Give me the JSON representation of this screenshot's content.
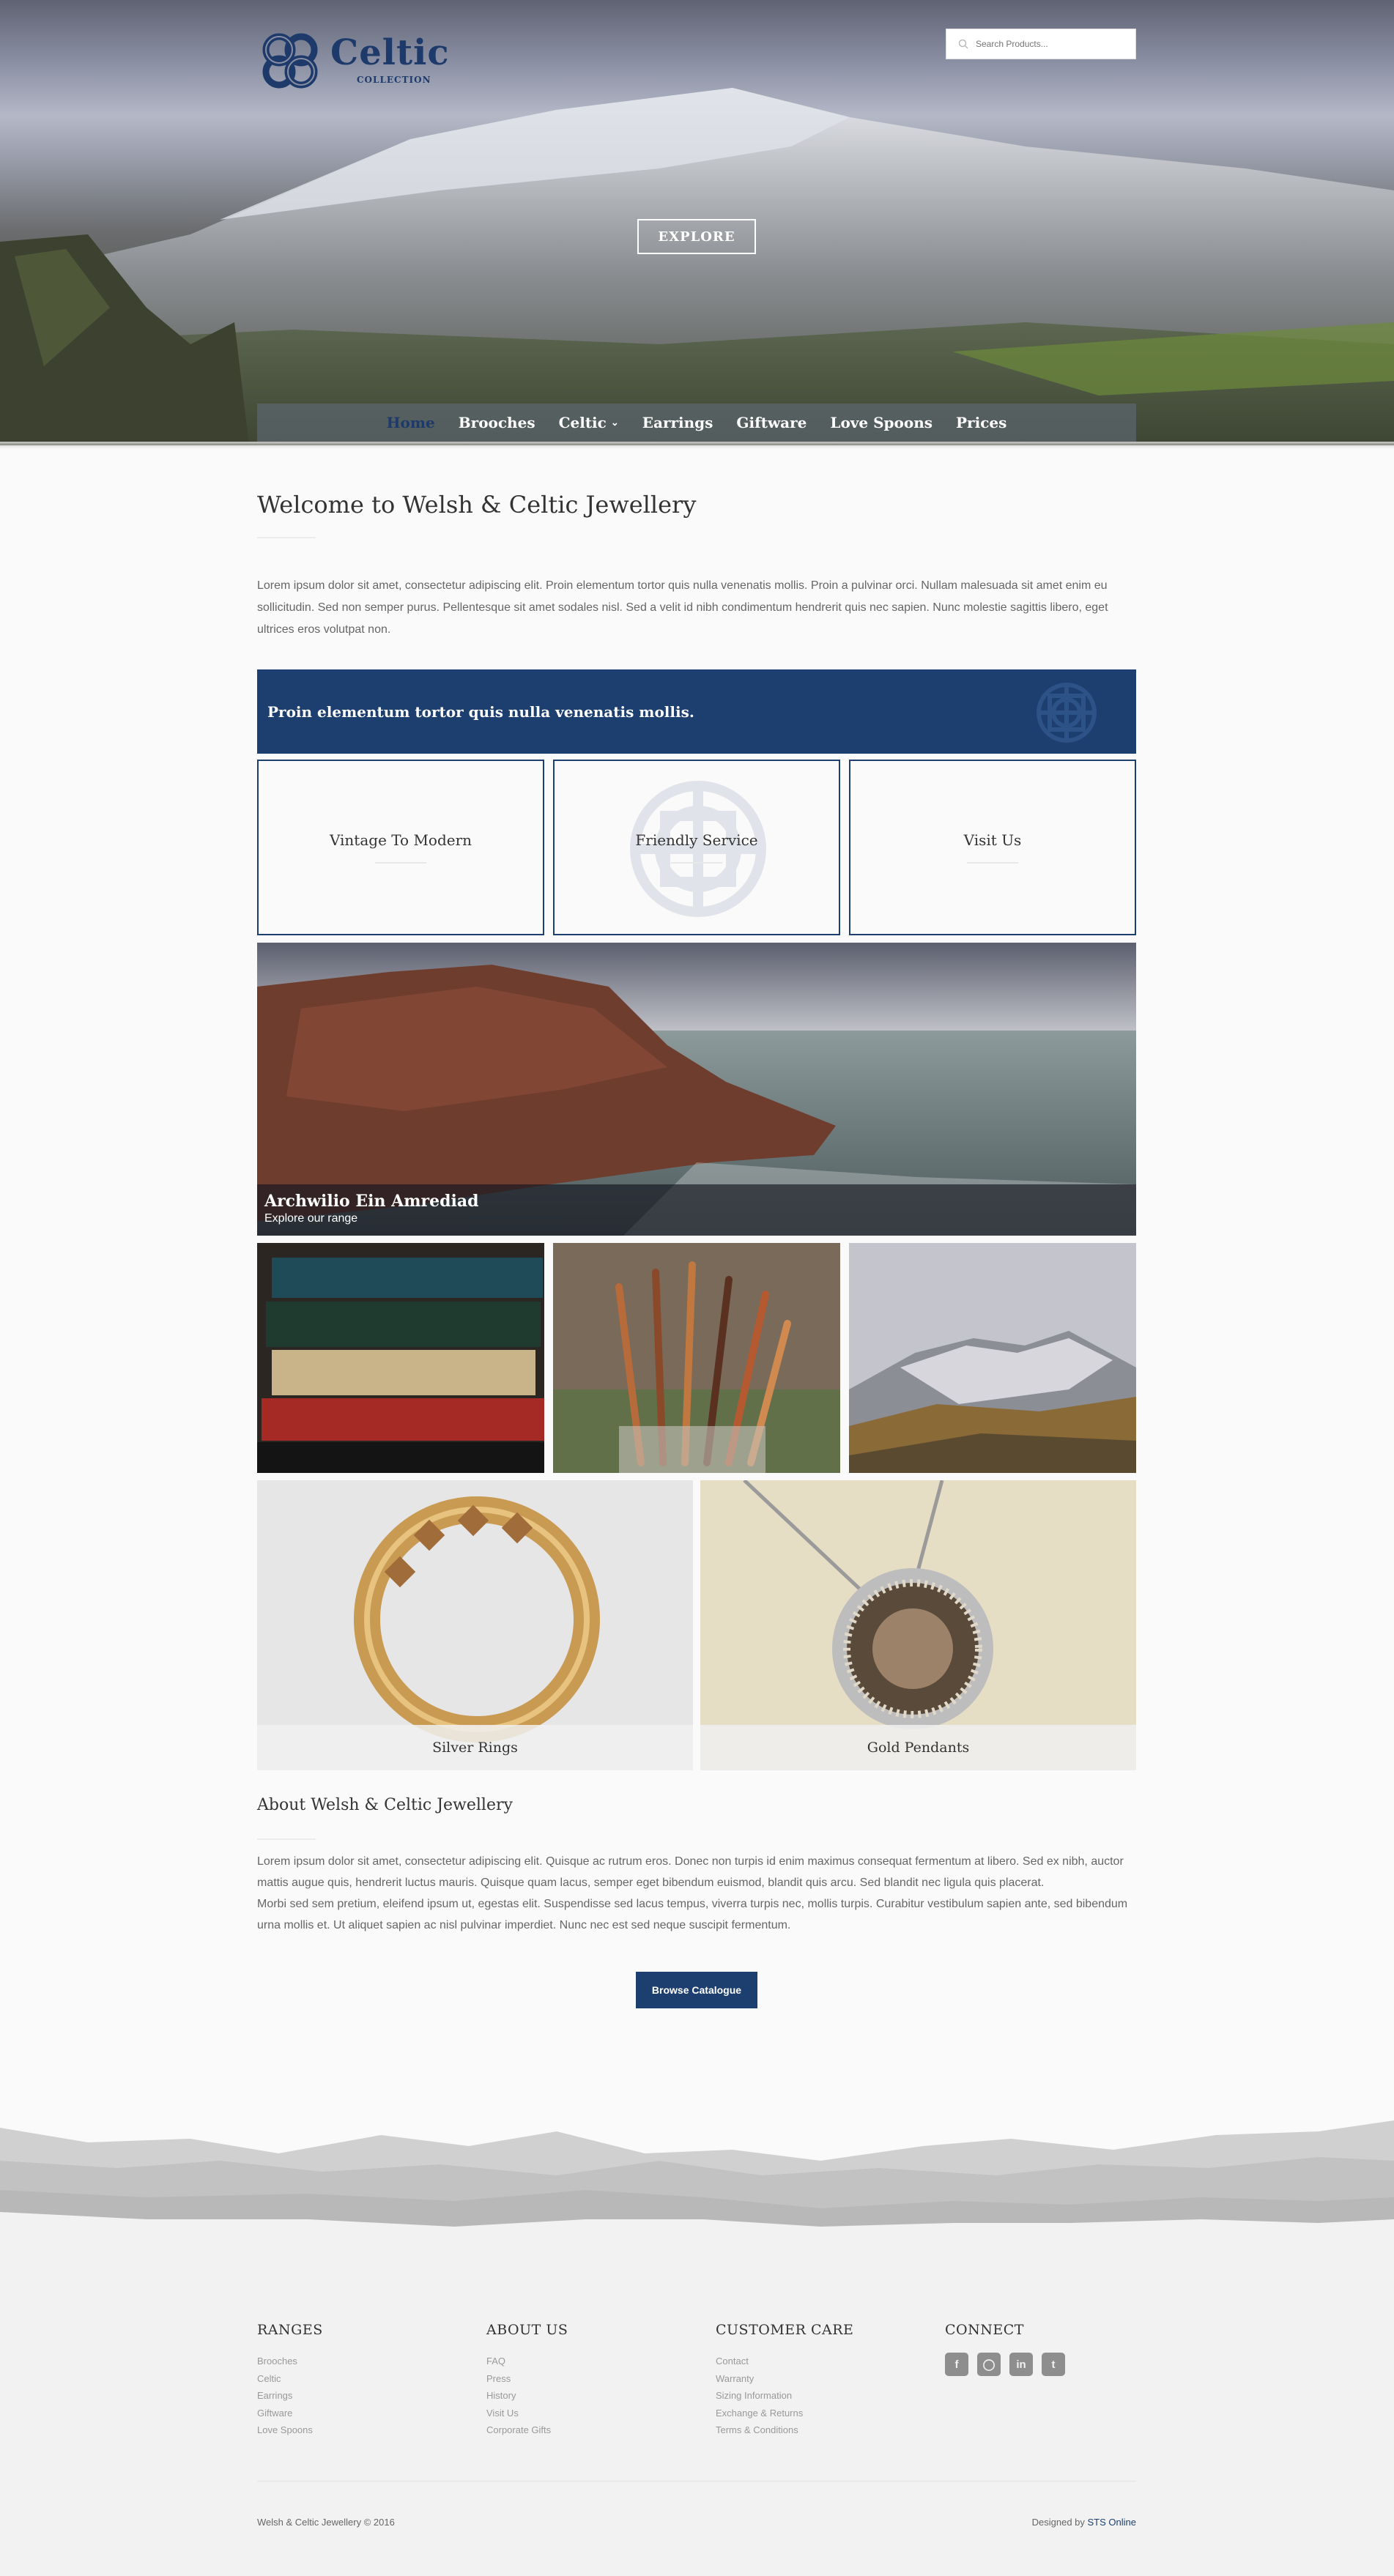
{
  "brand": {
    "name": "Celtic",
    "sub": "COLLECTION",
    "color": "#1d3a6b"
  },
  "search": {
    "placeholder": "Search Products..."
  },
  "hero": {
    "explore_label": "EXPLORE"
  },
  "nav": {
    "items": [
      {
        "label": "Home",
        "active": true
      },
      {
        "label": "Brooches"
      },
      {
        "label": "Celtic",
        "has_dropdown": true
      },
      {
        "label": "Earrings"
      },
      {
        "label": "Giftware"
      },
      {
        "label": "Love Spoons"
      },
      {
        "label": "Prices"
      }
    ]
  },
  "welcome": {
    "title": "Welcome to Welsh & Celtic Jewellery",
    "text": "Lorem ipsum dolor sit amet, consectetur adipiscing elit. Proin elementum tortor quis nulla venenatis mollis. Proin a pulvinar orci. Nullam malesuada sit amet enim eu sollicitudin. Sed non semper purus. Pellentesque sit amet sodales nisl. Sed a velit id nibh condimentum hendrerit quis nec sapien. Nunc molestie sagittis libero, eget ultrices eros volutpat non."
  },
  "banner": {
    "text": "Proin elementum tortor quis nulla venenatis mollis.",
    "bg": "#1d3f70"
  },
  "boxes": [
    "Vintage To Modern",
    "Friendly Service",
    "Visit Us"
  ],
  "feature": {
    "title": "Archwilio Ein Amrediad",
    "subtitle": "Explore our range"
  },
  "products": [
    "Silver Rings",
    "Gold Pendants"
  ],
  "about": {
    "title": "About Welsh & Celtic Jewellery",
    "p1": "Lorem ipsum dolor sit amet, consectetur adipiscing elit. Quisque ac rutrum eros. Donec non turpis id enim maximus consequat fermentum at libero. Sed ex nibh, auctor mattis augue quis, hendrerit luctus mauris. Quisque quam lacus, semper eget bibendum euismod, blandit quis arcu. Sed blandit nec ligula quis placerat.",
    "p2": "Morbi sed sem pretium, eleifend ipsum ut, egestas elit. Suspendisse sed lacus tempus, viverra turpis nec, mollis turpis. Curabitur vestibulum sapien ante, sed bibendum urna mollis et. Ut aliquet sapien ac nisl pulvinar imperdiet. Nunc nec est sed neque suscipit fermentum.",
    "button": "Browse Catalogue"
  },
  "footer": {
    "ranges": {
      "title": "RANGES",
      "links": [
        "Brooches",
        "Celtic",
        "Earrings",
        "Giftware",
        "Love Spoons"
      ]
    },
    "about_us": {
      "title": "ABOUT US",
      "links": [
        "FAQ",
        "Press",
        "History",
        "Visit Us",
        "Corporate Gifts"
      ]
    },
    "customer_care": {
      "title": "CUSTOMER CARE",
      "links": [
        "Contact",
        "Warranty",
        "Sizing Information",
        "Exchange & Returns",
        "Terms & Conditions"
      ]
    },
    "connect": {
      "title": "CONNECT",
      "icons": [
        "facebook-icon",
        "instagram-icon",
        "linkedin-icon",
        "twitter-icon"
      ]
    },
    "copyright": "Welsh & Celtic Jewellery © 2016",
    "designed_prefix": "Designed by ",
    "designed_by": "STS Online"
  }
}
